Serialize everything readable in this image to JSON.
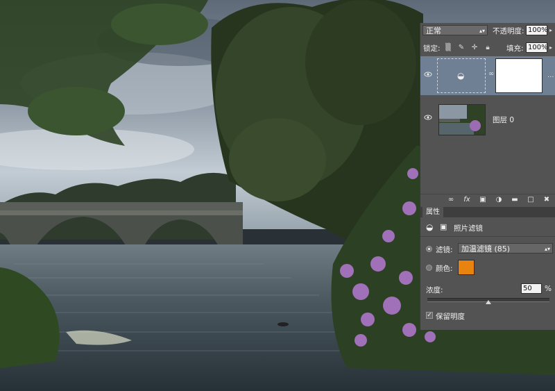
{
  "layers_panel": {
    "blend_mode": "正常",
    "opacity_label": "不透明度:",
    "opacity_value": "100%",
    "lock_label": "锁定:",
    "fill_label": "填充:",
    "fill_value": "100%",
    "layers": [
      {
        "name": "",
        "type": "adjustment-photo-filter",
        "selected": true,
        "visible": true
      },
      {
        "name": "图层 0",
        "type": "pixel",
        "selected": false,
        "visible": true
      }
    ],
    "more_indicator": "..."
  },
  "properties_panel": {
    "tab_label": "属性",
    "title": "照片滤镜",
    "filter_label": "滤镜:",
    "filter_value": "加温滤镜 (85)",
    "color_label": "颜色:",
    "color_value": "#e8830f",
    "density_label": "浓度:",
    "density_value": "50",
    "density_unit": "%",
    "density_fraction": 0.5,
    "preserve_label": "保留明度",
    "preserve_checked": true
  },
  "colors": {
    "panel_bg": "#535353",
    "selected_layer": "#6f7f94",
    "warming_orange": "#e8830f"
  }
}
